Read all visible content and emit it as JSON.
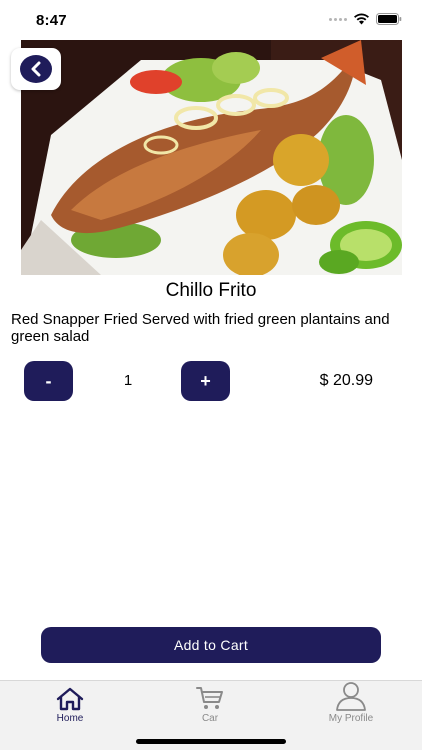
{
  "status_bar": {
    "time": "8:47",
    "icons": [
      "signal-icon",
      "wifi-icon",
      "battery-icon"
    ]
  },
  "header": {
    "back_icon": "chevron-left-icon"
  },
  "product": {
    "name": "Chillo Frito",
    "description": "Red Snapper Fried Served with fried green plantains and green salad",
    "image_subject": "fried-red-snapper-plate",
    "quantity": "1",
    "price": "$ 20.99"
  },
  "quantity_controls": {
    "decrement_label": "-",
    "increment_label": "+"
  },
  "actions": {
    "add_to_cart_label": "Add to Cart"
  },
  "tab_bar": {
    "items": [
      {
        "label": "Home",
        "icon": "home-icon",
        "active": true
      },
      {
        "label": "Car",
        "icon": "cart-icon",
        "active": false
      },
      {
        "label": "My Profile",
        "icon": "user-icon",
        "active": false
      }
    ]
  },
  "colors": {
    "primary": "#1f1c5a",
    "tab_active": "#1f1c5a",
    "tab_inactive": "#8a8a8a",
    "tab_bar_bg": "#f2f2f2"
  }
}
